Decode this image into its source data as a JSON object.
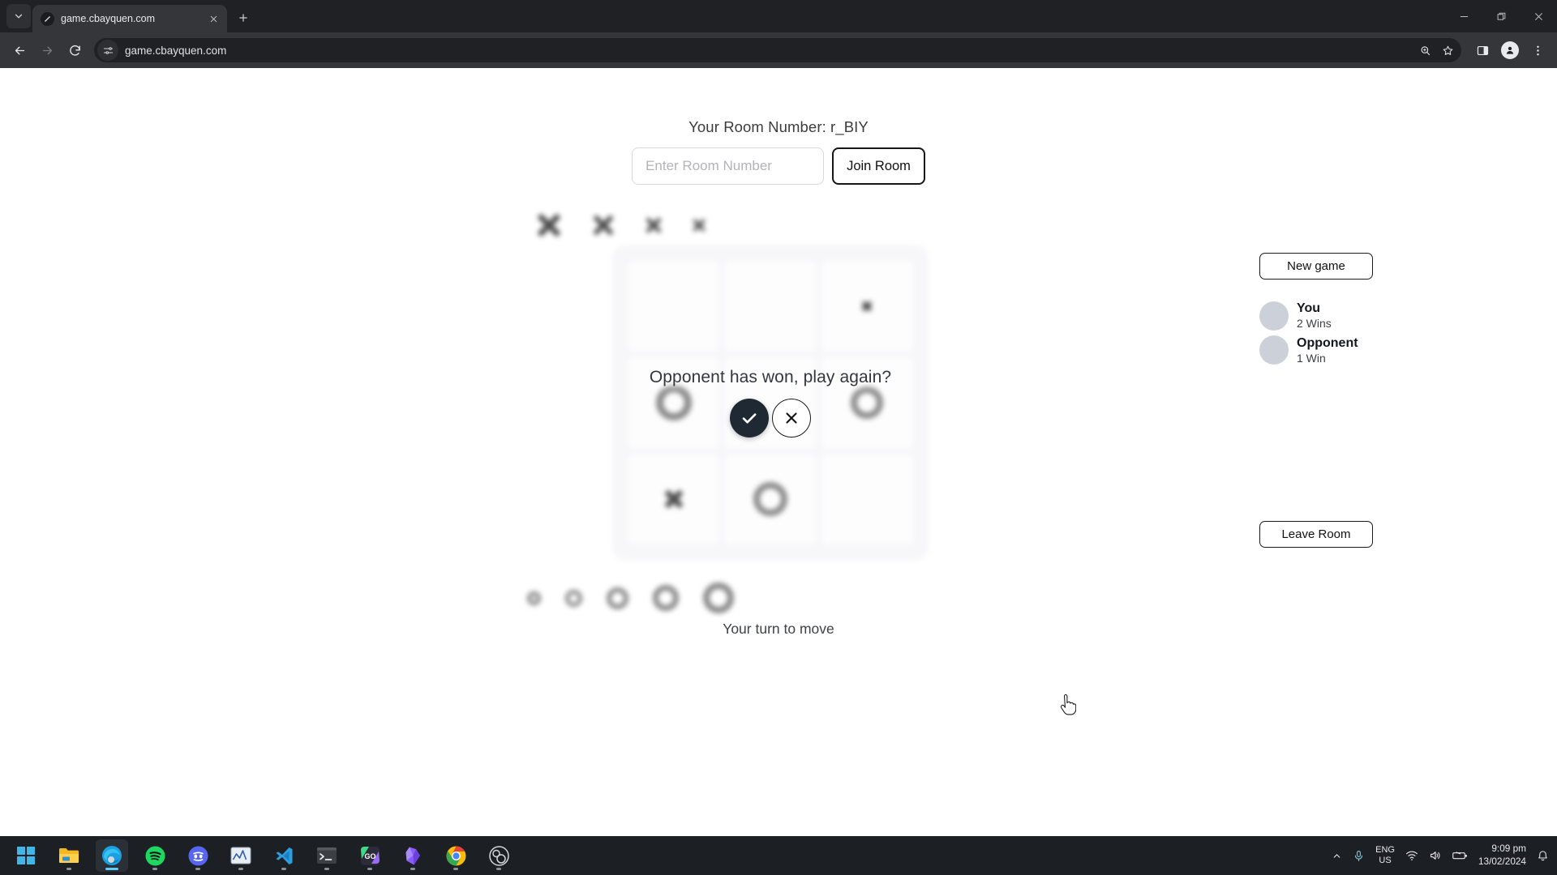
{
  "browser": {
    "tab": {
      "title": "game.cbayquen.com",
      "favicon_icon": "slash-circle-icon",
      "close_icon": "close-icon"
    },
    "tab_list_icon": "chevron-down-icon",
    "new_tab_icon": "plus-icon",
    "window_controls": {
      "minimize": "minimize-icon",
      "maximize": "restore-icon",
      "close": "close-icon"
    },
    "nav": {
      "back_icon": "back-arrow-icon",
      "forward_icon": "forward-arrow-icon",
      "reload_icon": "reload-icon"
    },
    "omnibox": {
      "url": "game.cbayquen.com",
      "site_settings_icon": "tune-icon"
    },
    "actions": {
      "zoom_icon": "search-zoom-icon",
      "bookmark_icon": "star-icon",
      "side_panel_icon": "side-panel-icon",
      "profile_icon": "person-icon",
      "menu_icon": "three-dot-menu-icon"
    }
  },
  "page": {
    "room_label": "Your Room Number: r_BIY",
    "room_input_placeholder": "Enter Room Number",
    "room_input_value": "",
    "join_button": "Join Room",
    "turn_status": "Your turn to move",
    "dialog": {
      "message": "Opponent has won, play again?",
      "confirm_icon": "check-icon",
      "decline_icon": "close-icon"
    },
    "sidebar": {
      "new_game_button": "New game",
      "leave_room_button": "Leave Room",
      "players": [
        {
          "name": "You",
          "score": "2 Wins"
        },
        {
          "name": "Opponent",
          "score": "1 Win"
        }
      ]
    },
    "captured_x": [
      {
        "size": 34,
        "stroke": 7
      },
      {
        "size": 30,
        "stroke": 6
      },
      {
        "size": 23,
        "stroke": 5
      },
      {
        "size": 19,
        "stroke": 4
      }
    ],
    "captured_o": [
      {
        "size": 17,
        "stroke": 5
      },
      {
        "size": 21,
        "stroke": 5
      },
      {
        "size": 27,
        "stroke": 6
      },
      {
        "size": 32,
        "stroke": 7
      },
      {
        "size": 38,
        "stroke": 8
      }
    ],
    "board": [
      {
        "mark": "",
        "size": 0,
        "stroke": 0
      },
      {
        "mark": "",
        "size": 0,
        "stroke": 0
      },
      {
        "mark": "x",
        "size": 14,
        "stroke": 5
      },
      {
        "mark": "o",
        "size": 44,
        "stroke": 9
      },
      {
        "mark": "",
        "size": 0,
        "stroke": 0
      },
      {
        "mark": "o",
        "size": 40,
        "stroke": 8
      },
      {
        "mark": "x",
        "size": 26,
        "stroke": 7
      },
      {
        "mark": "o",
        "size": 42,
        "stroke": 8
      },
      {
        "mark": "",
        "size": 0,
        "stroke": 0
      }
    ]
  },
  "taskbar": {
    "icons": [
      {
        "name": "start-windows-icon"
      },
      {
        "name": "file-explorer-icon"
      },
      {
        "name": "microsoft-edge-icon"
      },
      {
        "name": "spotify-icon"
      },
      {
        "name": "discord-icon"
      },
      {
        "name": "chart-app-icon"
      },
      {
        "name": "vs-code-icon"
      },
      {
        "name": "terminal-icon"
      },
      {
        "name": "goland-icon"
      },
      {
        "name": "obsidian-icon"
      },
      {
        "name": "google-chrome-icon"
      },
      {
        "name": "obs-studio-icon"
      }
    ],
    "tray": {
      "overflow_icon": "chevron-up-icon",
      "mic_icon": "microphone-icon",
      "language_primary": "ENG",
      "language_secondary": "US",
      "wifi_icon": "wifi-icon",
      "volume_icon": "speaker-icon",
      "battery_icon": "battery-icon",
      "time": "9:09 pm",
      "date": "13/02/2024",
      "notifications_icon": "bell-icon"
    }
  },
  "colors": {
    "chrome_dark": "#35363a",
    "tabstrip": "#202124",
    "taskbar": "#1c1f24",
    "accent_dark": "#1f2933",
    "avatar_gray": "#ccd1d9"
  }
}
